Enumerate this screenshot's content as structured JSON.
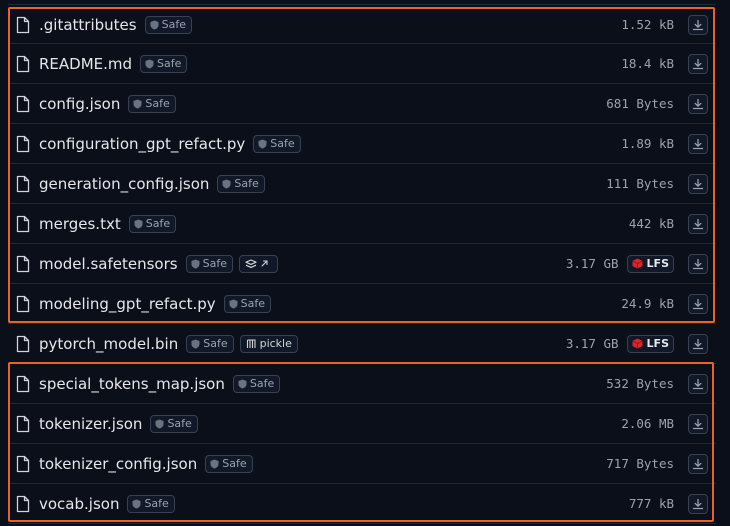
{
  "files": [
    {
      "name": ".gitattributes",
      "badge": "Safe",
      "size": "1.52 kB"
    },
    {
      "name": "README.md",
      "badge": "Safe",
      "size": "18.4 kB"
    },
    {
      "name": "config.json",
      "badge": "Safe",
      "size": "681 Bytes"
    },
    {
      "name": "configuration_gpt_refact.py",
      "badge": "Safe",
      "size": "1.89 kB"
    },
    {
      "name": "generation_config.json",
      "badge": "Safe",
      "size": "111 Bytes"
    },
    {
      "name": "merges.txt",
      "badge": "Safe",
      "size": "442 kB"
    },
    {
      "name": "model.safetensors",
      "badge": "Safe",
      "size": "3.17 GB",
      "lfs": "LFS",
      "tool": "safetensors"
    },
    {
      "name": "modeling_gpt_refact.py",
      "badge": "Safe",
      "size": "24.9 kB"
    },
    {
      "name": "pytorch_model.bin",
      "badge": "Safe",
      "size": "3.17 GB",
      "lfs": "LFS",
      "tool": "pickle",
      "tool_label": "pickle"
    },
    {
      "name": "special_tokens_map.json",
      "badge": "Safe",
      "size": "532 Bytes"
    },
    {
      "name": "tokenizer.json",
      "badge": "Safe",
      "size": "2.06 MB"
    },
    {
      "name": "tokenizer_config.json",
      "badge": "Safe",
      "size": "717 Bytes"
    },
    {
      "name": "vocab.json",
      "badge": "Safe",
      "size": "777 kB"
    }
  ],
  "colors": {
    "background": "#0b0f19",
    "text": "#e5e7eb",
    "muted": "#9ca3af",
    "border": "#1f2937",
    "highlight": "#e8622a",
    "lfs_icon": "#dc2626"
  }
}
